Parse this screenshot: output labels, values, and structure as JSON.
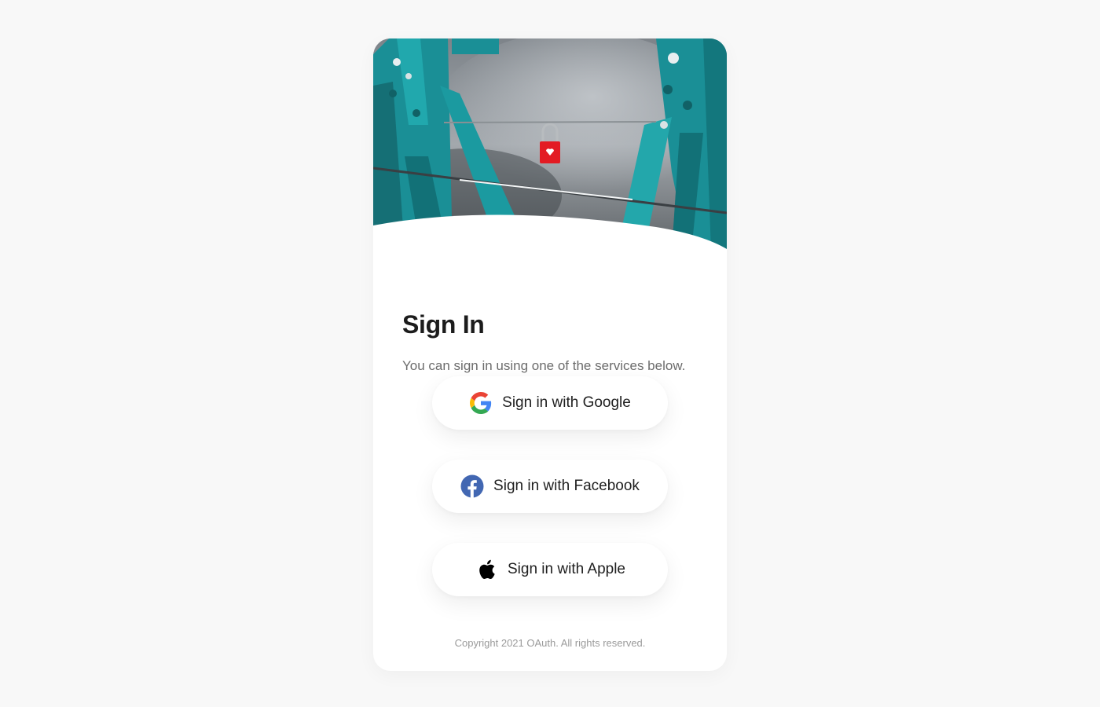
{
  "hero": {
    "image": "padlock-on-bridge-photo"
  },
  "signin": {
    "title": "Sign In",
    "subtitle": "You can sign in using one of the services below."
  },
  "buttons": [
    {
      "label": "Sign in with Google",
      "icon": "google-icon"
    },
    {
      "label": "Sign in with Facebook",
      "icon": "facebook-icon"
    },
    {
      "label": "Sign in with Apple",
      "icon": "apple-icon"
    }
  ],
  "footer": {
    "copyright": "Copyright 2021 OAuth. All rights reserved."
  },
  "colors": {
    "page_bg": "#f8f8f8",
    "card_bg": "#ffffff",
    "facebook_blue": "#4267b2",
    "bridge_teal": "#1e9ba0",
    "lock_red": "#e31b23"
  }
}
